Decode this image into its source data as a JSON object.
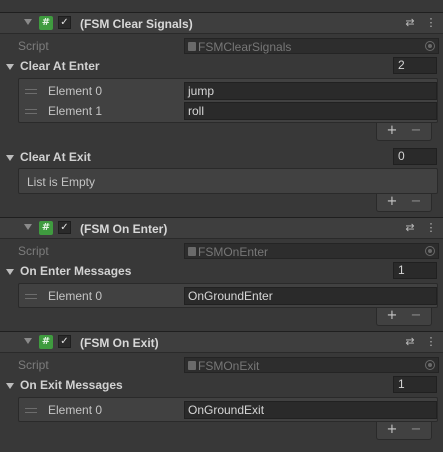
{
  "components": [
    {
      "title": "(FSM Clear Signals)",
      "script_label": "Script",
      "script_value": "FSMClearSignals",
      "script_icon": "#",
      "enabled_mark": "✓",
      "lists": [
        {
          "label": "Clear At Enter",
          "count": "2",
          "elements": [
            {
              "label": "Element 0",
              "value": "jump"
            },
            {
              "label": "Element 1",
              "value": "roll"
            }
          ]
        },
        {
          "label": "Clear At Exit",
          "count": "0",
          "empty_text": "List is Empty",
          "elements": []
        }
      ]
    },
    {
      "title": "(FSM On Enter)",
      "script_label": "Script",
      "script_value": "FSMOnEnter",
      "script_icon": "#",
      "enabled_mark": "✓",
      "lists": [
        {
          "label": "On Enter Messages",
          "count": "1",
          "elements": [
            {
              "label": "Element 0",
              "value": "OnGroundEnter"
            }
          ]
        }
      ]
    },
    {
      "title": "(FSM On Exit)",
      "script_label": "Script",
      "script_value": "FSMOnExit",
      "script_icon": "#",
      "enabled_mark": "✓",
      "lists": [
        {
          "label": "On Exit Messages",
          "count": "1",
          "elements": [
            {
              "label": "Element 0",
              "value": "OnGroundExit"
            }
          ]
        }
      ]
    }
  ],
  "footer_buttons": {
    "add": "+",
    "remove": "−"
  },
  "header_icons": {
    "presets": "⇄",
    "menu": "⋮"
  },
  "colors": {
    "background": "#383838",
    "script_icon": "#3f9b3f"
  }
}
